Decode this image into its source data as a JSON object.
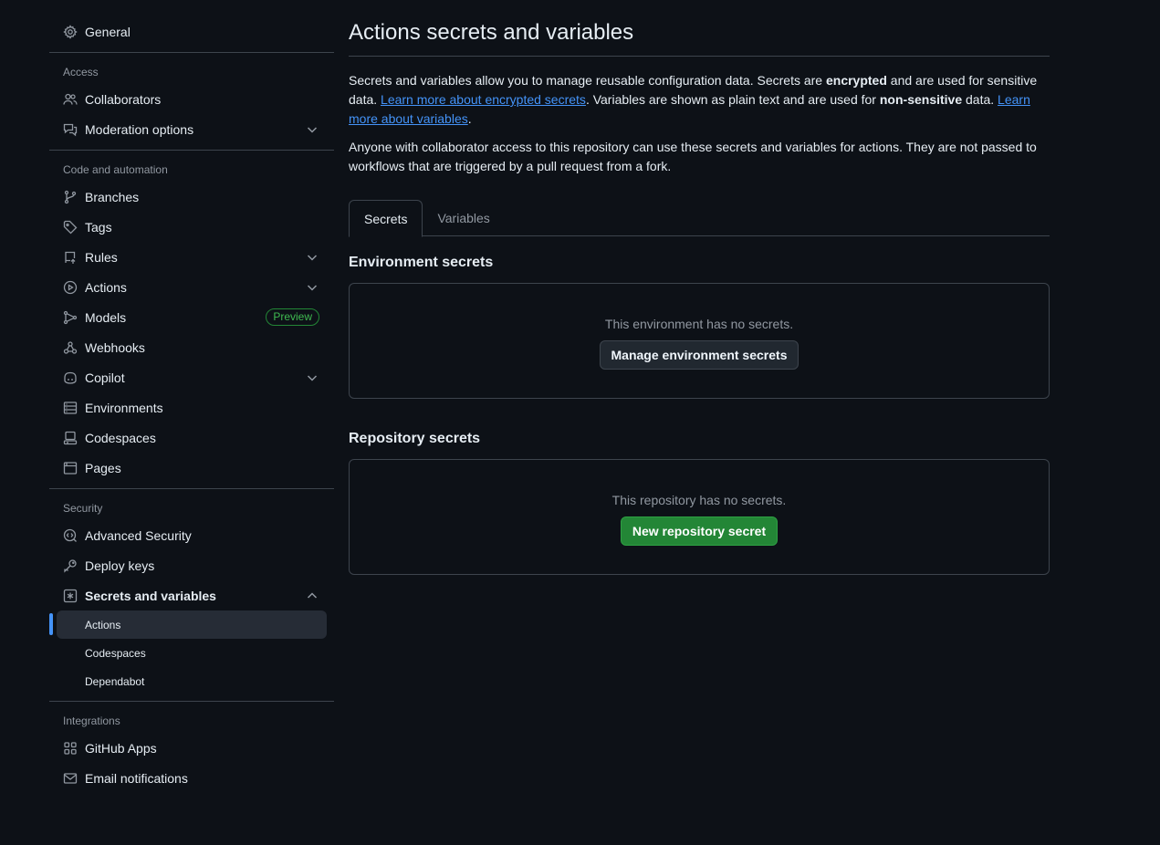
{
  "sidebar": {
    "general": {
      "label": "General",
      "icon": "gear-icon"
    },
    "sections": [
      {
        "title": "Access"
      },
      {
        "title": "Code and automation"
      },
      {
        "title": "Security"
      },
      {
        "title": "Integrations"
      }
    ],
    "access": [
      {
        "label": "Collaborators",
        "icon": "people-icon"
      },
      {
        "label": "Moderation options",
        "icon": "comment-discussion-icon",
        "expandable": true
      }
    ],
    "code": [
      {
        "label": "Branches",
        "icon": "git-branch-icon"
      },
      {
        "label": "Tags",
        "icon": "tag-icon"
      },
      {
        "label": "Rules",
        "icon": "repo-push-icon",
        "expandable": true
      },
      {
        "label": "Actions",
        "icon": "play-icon",
        "expandable": true
      },
      {
        "label": "Models",
        "icon": "ai-model-icon",
        "badge": "Preview"
      },
      {
        "label": "Webhooks",
        "icon": "webhook-icon"
      },
      {
        "label": "Copilot",
        "icon": "copilot-icon",
        "expandable": true
      },
      {
        "label": "Environments",
        "icon": "server-icon"
      },
      {
        "label": "Codespaces",
        "icon": "codespaces-icon"
      },
      {
        "label": "Pages",
        "icon": "browser-icon"
      }
    ],
    "security": [
      {
        "label": "Advanced Security",
        "icon": "codescan-icon"
      },
      {
        "label": "Deploy keys",
        "icon": "key-icon"
      },
      {
        "label": "Secrets and variables",
        "icon": "key-asterisk-icon",
        "expanded": true
      }
    ],
    "secrets_sub": [
      {
        "label": "Actions",
        "active": true
      },
      {
        "label": "Codespaces"
      },
      {
        "label": "Dependabot"
      }
    ],
    "integrations": [
      {
        "label": "GitHub Apps",
        "icon": "apps-icon"
      },
      {
        "label": "Email notifications",
        "icon": "mail-icon"
      }
    ]
  },
  "main": {
    "title": "Actions secrets and variables",
    "intro": {
      "p1_a": "Secrets and variables allow you to manage reusable configuration data. Secrets are ",
      "p1_b": "encrypted",
      "p1_c": " and are used for sensitive data. ",
      "p1_link1": "Learn more about encrypted secrets",
      "p1_d": ". Variables are shown as plain text and are used for ",
      "p1_e": "non-sensitive",
      "p1_f": " data. ",
      "p1_link2": "Learn more about variables",
      "p1_g": ".",
      "p2": "Anyone with collaborator access to this repository can use these secrets and variables for actions. They are not passed to workflows that are triggered by a pull request from a fork."
    },
    "tabs": [
      {
        "label": "Secrets",
        "selected": true
      },
      {
        "label": "Variables",
        "selected": false
      }
    ],
    "environment": {
      "heading": "Environment secrets",
      "empty": "This environment has no secrets.",
      "button": "Manage environment secrets"
    },
    "repository": {
      "heading": "Repository secrets",
      "empty": "This repository has no secrets.",
      "button": "New repository secret"
    }
  },
  "colors": {
    "background": "#0d1117",
    "accent": "#4493f8",
    "primary_button": "#238636",
    "border": "#3d444d"
  }
}
